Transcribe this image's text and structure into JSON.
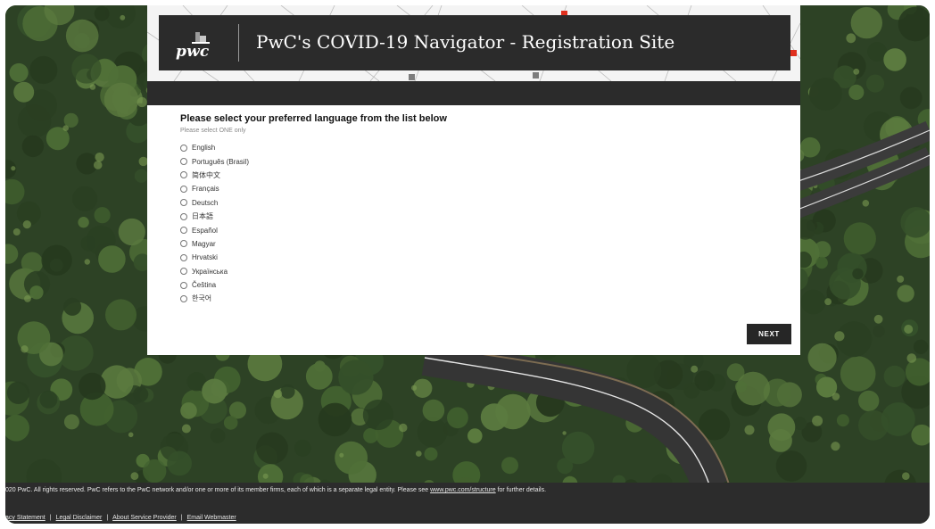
{
  "colors": {
    "accent": "#e0301e",
    "header_dark": "#2b2b2b",
    "footer_dark": "#2c2c2c",
    "forest": "#2f4526"
  },
  "header": {
    "logo_text": "pwc",
    "title": "PwC's COVID-19 Navigator - Registration Site"
  },
  "form": {
    "question": "Please select your preferred language from the list below",
    "hint": "Please select ONE only",
    "options": [
      {
        "label": "English"
      },
      {
        "label": "Português (Brasil)"
      },
      {
        "label": "简体中文"
      },
      {
        "label": "Français"
      },
      {
        "label": "Deutsch"
      },
      {
        "label": "日本語"
      },
      {
        "label": "Español"
      },
      {
        "label": "Magyar"
      },
      {
        "label": "Hrvatski"
      },
      {
        "label": "Українська"
      },
      {
        "label": "Čeština"
      },
      {
        "label": "한국어"
      }
    ],
    "next_label": "NEXT"
  },
  "footer": {
    "copyright_text": "020 PwC. All rights reserved. PwC refers to the PwC network and/or one or more of its member firms, each of which is a separate legal entity. Please see",
    "copyright_link": "www.pwc.com/structure",
    "copyright_tail": "for further details.",
    "links": [
      {
        "label": "acy Statement"
      },
      {
        "label": "Legal Disclaimer"
      },
      {
        "label": "About Service Provider"
      },
      {
        "label": "Email Webmaster"
      }
    ],
    "separator": "|"
  }
}
